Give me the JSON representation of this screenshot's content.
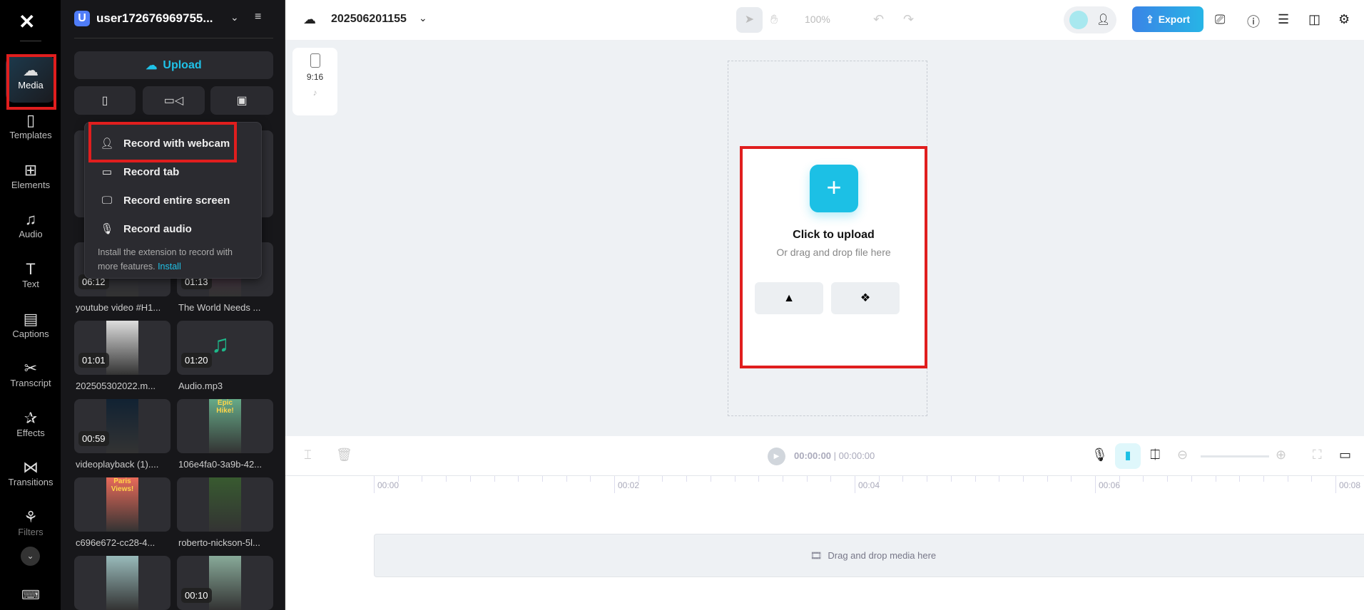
{
  "rail": {
    "items": [
      {
        "label": "Media",
        "icon": "cloud-upload-icon"
      },
      {
        "label": "Templates",
        "icon": "templates-icon"
      },
      {
        "label": "Elements",
        "icon": "elements-icon"
      },
      {
        "label": "Audio",
        "icon": "music-note-icon"
      },
      {
        "label": "Text",
        "icon": "text-icon"
      },
      {
        "label": "Captions",
        "icon": "captions-icon"
      },
      {
        "label": "Transcript",
        "icon": "transcript-icon"
      },
      {
        "label": "Effects",
        "icon": "effects-icon"
      },
      {
        "label": "Transitions",
        "icon": "transitions-icon"
      },
      {
        "label": "Filters",
        "icon": "filters-icon"
      }
    ]
  },
  "panel": {
    "avatar_letter": "U",
    "username": "user172676969755...",
    "upload_label": "Upload",
    "menu": {
      "items": [
        "Record with webcam",
        "Record tab",
        "Record entire screen",
        "Record audio"
      ],
      "note": "Install the extension to record with more features.",
      "install_link": "Install"
    },
    "media": [
      {
        "name": "youtube video #H1...",
        "duration": "06:12"
      },
      {
        "name": "The World Needs ...",
        "duration": "01:13"
      },
      {
        "name": "202505302022.m...",
        "duration": "01:01"
      },
      {
        "name": "Audio.mp3",
        "duration": "01:20"
      },
      {
        "name": "videoplayback (1)....",
        "duration": "00:59"
      },
      {
        "name": "106e4fa0-3a9b-42...",
        "duration": "",
        "overlay": "Epic Hike!"
      },
      {
        "name": "c696e672-cc28-4...",
        "duration": "",
        "overlay": "Paris Views!"
      },
      {
        "name": "roberto-nickson-5l...",
        "duration": ""
      },
      {
        "name": "",
        "duration": ""
      },
      {
        "name": "",
        "duration": "00:10"
      }
    ]
  },
  "topbar": {
    "project": "202506201155",
    "zoom": "100%",
    "export": "Export"
  },
  "canvas": {
    "ratio": "9:16",
    "upload_title": "Click to upload",
    "upload_sub": "Or drag and drop file here"
  },
  "timeline": {
    "time": "00:00:00",
    "total": "00:00:00",
    "ticks": [
      "00:00",
      "00:02",
      "00:04",
      "00:06",
      "00:08"
    ],
    "drop": "Drag and drop media here"
  },
  "colors": {
    "accent": "#1fc2e8",
    "export": "#3a8ee6",
    "highlight": "#e01e1e"
  }
}
